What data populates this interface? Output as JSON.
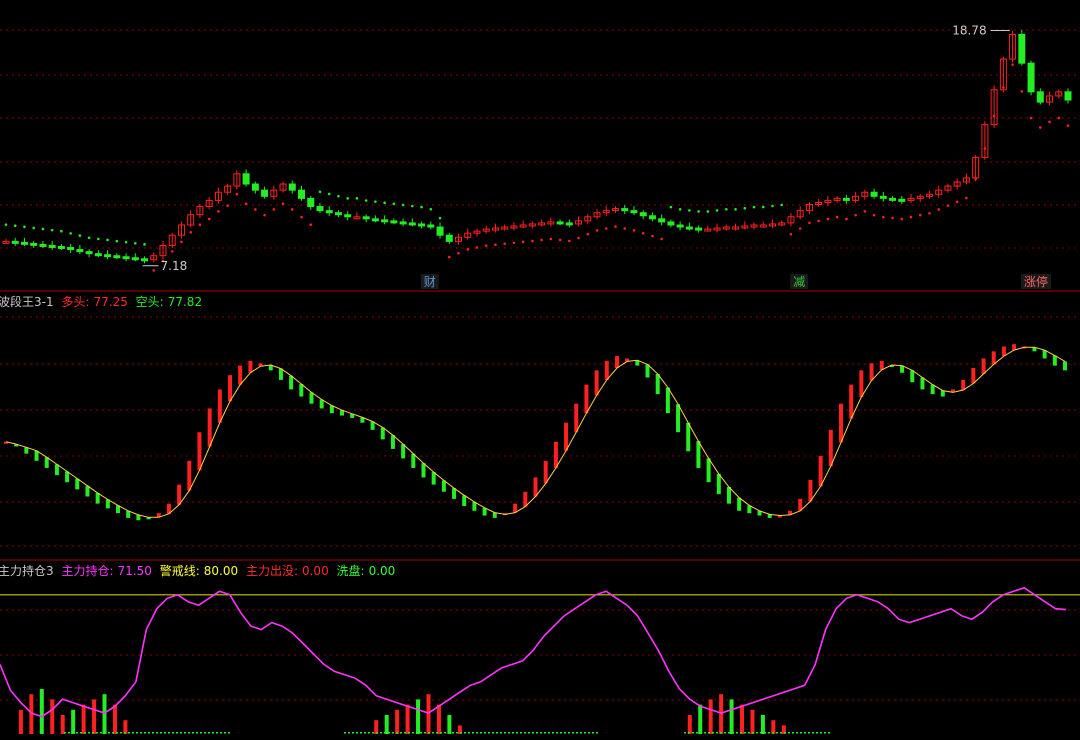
{
  "colors": {
    "background": "#000000",
    "up": "#ff2020",
    "down": "#22ee22",
    "grid": "#8b0000",
    "magenta": "#ff33ff",
    "yellow": "#cccc00",
    "text": "#c8c8c8"
  },
  "price_panel": {
    "high_marker": "18.78",
    "low_marker": "7.18",
    "event_labels": [
      "财",
      "减",
      "涨停"
    ]
  },
  "panel2": {
    "title": "波段王3-1",
    "duo_label": "多头:",
    "duo_value": "77.25",
    "kong_label": "空头:",
    "kong_value": "77.82"
  },
  "panel3": {
    "title": "主力持仓3",
    "hold_label": "主力持仓:",
    "hold_value": "71.50",
    "warn_label": "警戒线:",
    "warn_value": "80.00",
    "exit_label": "主力出没:",
    "exit_value": "0.00",
    "wash_label": "洗盘:",
    "wash_value": "0.00"
  },
  "chart_data": [
    {
      "type": "candlestick",
      "title": "",
      "annotations": [
        "18.78",
        "7.18",
        "财",
        "减",
        "涨停"
      ],
      "close": [
        8.1,
        8.05,
        8.0,
        7.95,
        7.9,
        7.85,
        7.8,
        7.7,
        7.6,
        7.5,
        7.45,
        7.4,
        7.35,
        7.3,
        7.25,
        7.2,
        7.4,
        7.9,
        8.4,
        8.9,
        9.4,
        9.8,
        10.1,
        10.5,
        10.8,
        11.4,
        10.9,
        10.6,
        10.3,
        10.6,
        10.9,
        10.6,
        10.2,
        9.8,
        9.6,
        9.5,
        9.4,
        9.3,
        9.3,
        9.2,
        9.15,
        9.1,
        9.05,
        9.0,
        8.95,
        8.9,
        8.8,
        8.4,
        8.1,
        8.3,
        8.5,
        8.6,
        8.7,
        8.75,
        8.8,
        8.85,
        8.9,
        8.95,
        9.0,
        9.05,
        9.0,
        8.95,
        9.1,
        9.3,
        9.5,
        9.6,
        9.7,
        9.6,
        9.5,
        9.35,
        9.2,
        9.05,
        8.9,
        8.8,
        8.75,
        8.7,
        8.7,
        8.75,
        8.8,
        8.8,
        8.85,
        8.9,
        8.9,
        8.95,
        9.0,
        9.3,
        9.6,
        9.9,
        10.0,
        10.1,
        10.2,
        10.1,
        10.3,
        10.5,
        10.3,
        10.2,
        10.15,
        10.1,
        10.2,
        10.3,
        10.4,
        10.6,
        10.8,
        11.0,
        11.2,
        12.2,
        13.8,
        15.5,
        17.0,
        18.2,
        16.8,
        15.4,
        14.9,
        15.2,
        15.4,
        15.0
      ]
    },
    {
      "type": "bar",
      "title": "波段王3-1",
      "series": [
        {
          "name": "多头",
          "last": 77.25
        },
        {
          "name": "空头",
          "last": 77.82
        }
      ],
      "values": [
        48,
        46,
        43,
        40,
        37,
        34,
        31,
        28,
        25,
        22,
        20,
        18,
        16,
        15,
        16,
        18,
        22,
        30,
        40,
        52,
        62,
        70,
        76,
        80,
        82,
        81,
        78,
        74,
        70,
        67,
        64,
        62,
        60,
        59,
        58,
        56,
        53,
        49,
        45,
        41,
        37,
        33,
        30,
        27,
        24,
        21,
        19,
        17,
        16,
        18,
        22,
        27,
        33,
        40,
        48,
        56,
        64,
        72,
        78,
        82,
        84,
        83,
        80,
        75,
        68,
        60,
        52,
        44,
        37,
        31,
        26,
        22,
        19,
        18,
        17,
        16,
        17,
        19,
        24,
        32,
        42,
        53,
        64,
        72,
        78,
        81,
        82,
        80,
        77,
        73,
        70,
        68,
        67,
        70,
        74,
        79,
        83,
        86,
        88,
        89,
        88,
        86,
        83,
        80,
        78
      ]
    },
    {
      "type": "line",
      "title": "主力持仓3",
      "series": [
        {
          "name": "主力持仓",
          "last": 71.5,
          "values": [
            40,
            25,
            18,
            12,
            10,
            14,
            20,
            18,
            16,
            14,
            12,
            16,
            22,
            30,
            60,
            72,
            78,
            80,
            76,
            74,
            78,
            82,
            80,
            70,
            62,
            60,
            64,
            62,
            58,
            52,
            46,
            40,
            36,
            34,
            32,
            28,
            22,
            20,
            18,
            16,
            14,
            12,
            16,
            20,
            24,
            28,
            30,
            34,
            38,
            40,
            42,
            48,
            56,
            62,
            68,
            72,
            76,
            80,
            82,
            78,
            74,
            68,
            58,
            48,
            36,
            26,
            20,
            16,
            14,
            12,
            14,
            16,
            18,
            20,
            22,
            24,
            26,
            28,
            40,
            60,
            72,
            78,
            80,
            78,
            76,
            72,
            66,
            64,
            66,
            68,
            70,
            72,
            68,
            66,
            70,
            76,
            80,
            82,
            84,
            80,
            76,
            72,
            71.5
          ]
        },
        {
          "name": "警戒线",
          "last": 80.0
        },
        {
          "name": "主力出没",
          "last": 0.0
        },
        {
          "name": "洗盘",
          "last": 0.0
        }
      ]
    }
  ]
}
